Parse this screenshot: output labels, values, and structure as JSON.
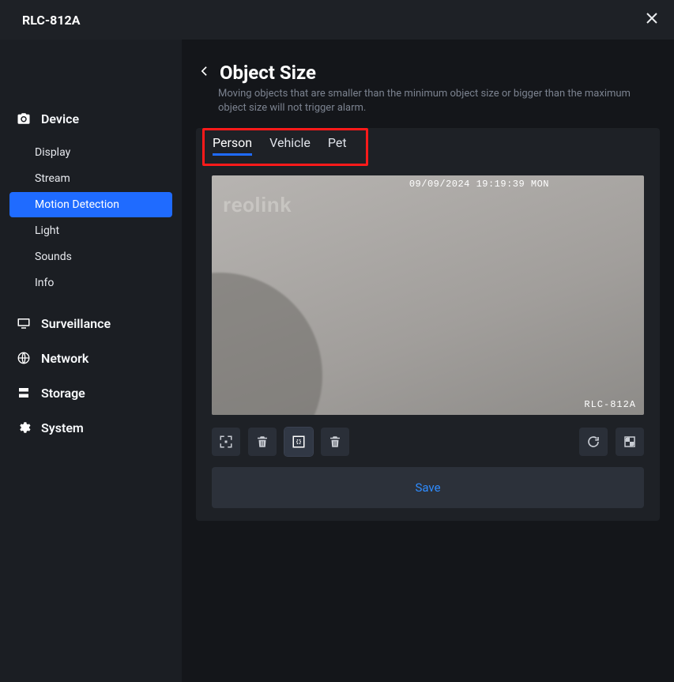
{
  "titlebar": {
    "title": "RLC-812A"
  },
  "sidebar": {
    "categories": [
      {
        "id": "device",
        "label": "Device",
        "expanded": true,
        "items": [
          {
            "id": "display",
            "label": "Display"
          },
          {
            "id": "stream",
            "label": "Stream"
          },
          {
            "id": "motion",
            "label": "Motion Detection",
            "active": true
          },
          {
            "id": "light",
            "label": "Light"
          },
          {
            "id": "sounds",
            "label": "Sounds"
          },
          {
            "id": "info",
            "label": "Info"
          }
        ]
      },
      {
        "id": "surveillance",
        "label": "Surveillance"
      },
      {
        "id": "network",
        "label": "Network"
      },
      {
        "id": "storage",
        "label": "Storage"
      },
      {
        "id": "system",
        "label": "System"
      }
    ]
  },
  "page": {
    "title": "Object Size",
    "description": "Moving objects that are smaller than the minimum object size or bigger than the maximum object size will not trigger alarm.",
    "tabs": [
      {
        "id": "person",
        "label": "Person",
        "active": true
      },
      {
        "id": "vehicle",
        "label": "Vehicle"
      },
      {
        "id": "pet",
        "label": "Pet"
      }
    ],
    "video": {
      "watermark": "reolink",
      "osd_time": "09/09/2024 19:19:39 MON",
      "osd_name": "RLC-812A"
    },
    "save_label": "Save"
  }
}
